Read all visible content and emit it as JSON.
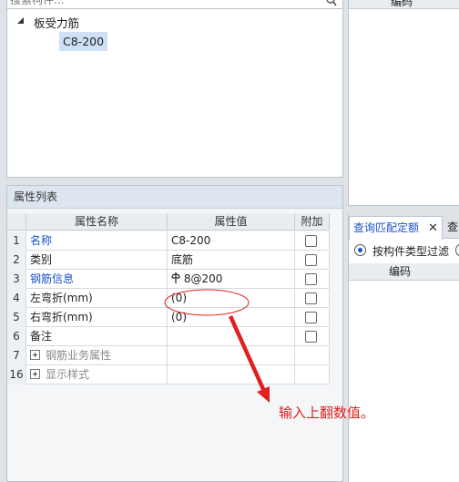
{
  "search": {
    "placeholder": "搜索构件..."
  },
  "tree": {
    "root": "板受力筋",
    "child": "C8-200"
  },
  "props": {
    "title": "属性列表",
    "headers": {
      "name": "属性名称",
      "value": "属性值",
      "extra": "附加"
    },
    "rows": [
      {
        "num": "1",
        "name": "名称",
        "value": "C8-200"
      },
      {
        "num": "2",
        "name": "类别",
        "value": "底筋"
      },
      {
        "num": "3",
        "name": "钢筋信息",
        "value": " 8@200"
      },
      {
        "num": "4",
        "name": "左弯折(mm)",
        "value": "(0)"
      },
      {
        "num": "5",
        "name": "右弯折(mm)",
        "value": "(0)"
      },
      {
        "num": "6",
        "name": "备注",
        "value": ""
      },
      {
        "num": "7",
        "name": "钢筋业务属性",
        "value": ""
      },
      {
        "num": "16",
        "name": "显示样式",
        "value": ""
      }
    ]
  },
  "right": {
    "top_header": "编码",
    "tab_active": "查询匹配定额",
    "tab_next": "查",
    "radio_label": "按构件类型过滤",
    "code_header": "编码"
  },
  "annotation": {
    "text": "输入上翻数值。",
    "color": "#e02020"
  },
  "colors": {
    "link": "#1a52c8",
    "selection": "#cfe0f5"
  }
}
